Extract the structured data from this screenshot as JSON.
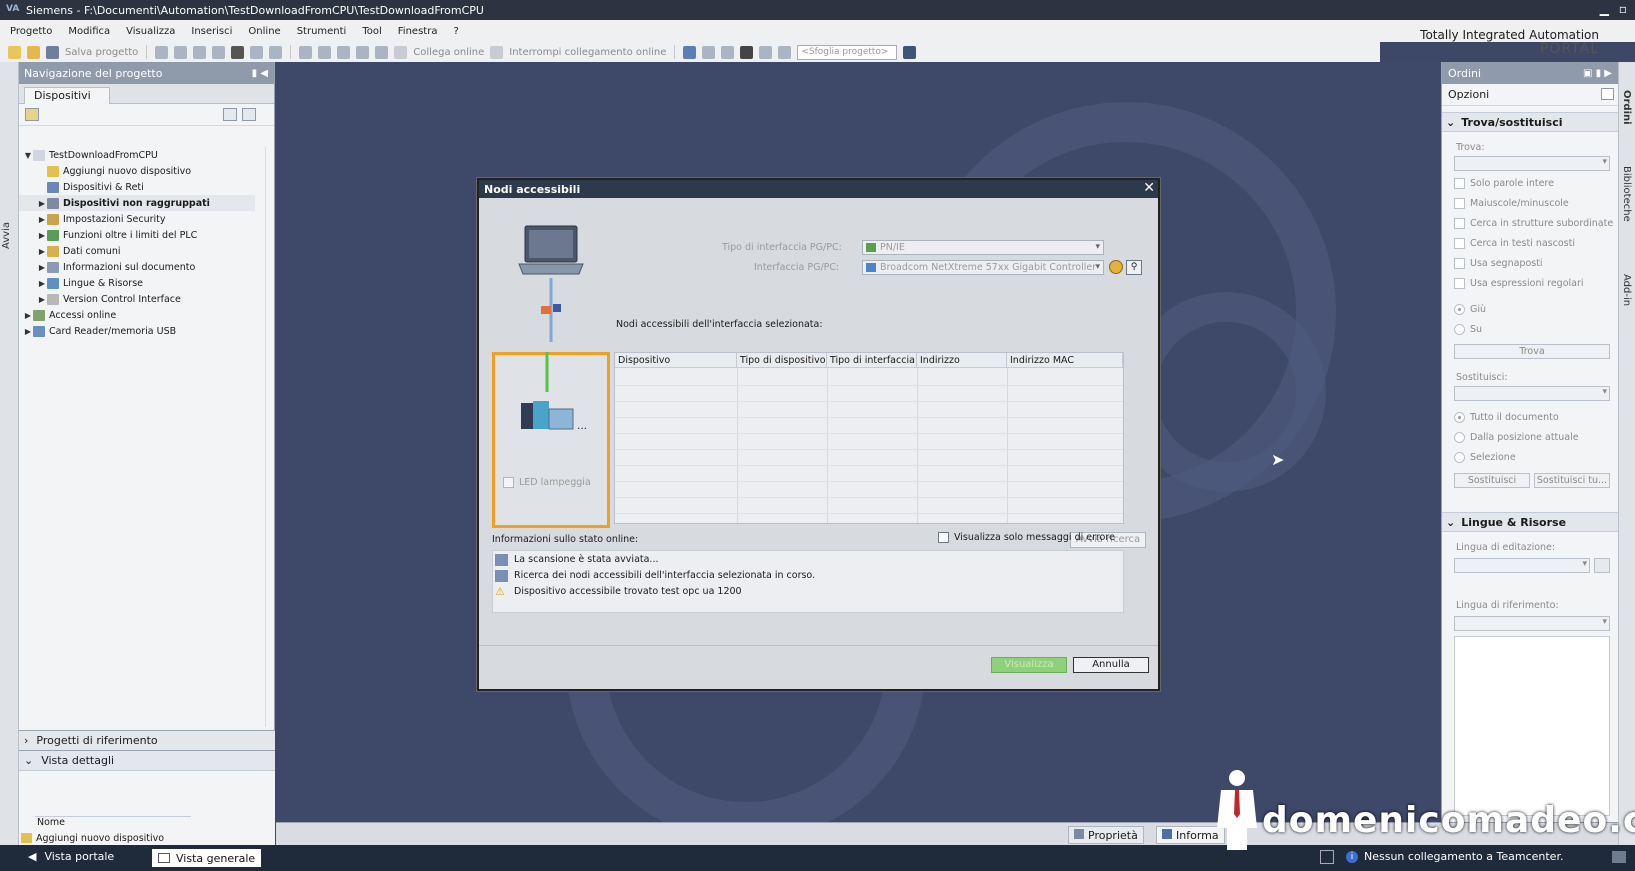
{
  "window": {
    "title": "Siemens  -  F:\\Documenti\\Automation\\TestDownloadFromCPU\\TestDownloadFromCPU"
  },
  "menu": [
    "Progetto",
    "Modifica",
    "Visualizza",
    "Inserisci",
    "Online",
    "Strumenti",
    "Tool",
    "Finestra",
    "?"
  ],
  "brand": {
    "line1": "Totally Integrated Automation",
    "line2": "PORTAL"
  },
  "toolbar": {
    "save_label": "Salva progetto",
    "go_online_label": "Collega online",
    "go_offline_label": "Interrompi collegamento online",
    "search_placeholder": "<Sfoglia progetto>"
  },
  "left_strip": {
    "label": "Avvia"
  },
  "project_nav": {
    "title": "Navigazione del progetto",
    "tab": "Dispositivi",
    "tree": [
      {
        "label": "TestDownloadFromCPU",
        "level": 0,
        "arrow": "▼",
        "color": "#cfd6e2"
      },
      {
        "label": "Aggiungi nuovo dispositivo",
        "level": 1,
        "arrow": "",
        "color": "#e2c24a"
      },
      {
        "label": "Dispositivi & Reti",
        "level": 1,
        "arrow": "",
        "color": "#6b86b8"
      },
      {
        "label": "Dispositivi non raggruppati",
        "level": 1,
        "arrow": "▶",
        "color": "#7d8aa0",
        "bold": true
      },
      {
        "label": "Impostazioni Security",
        "level": 1,
        "arrow": "▶",
        "color": "#c9a44a"
      },
      {
        "label": "Funzioni oltre i limiti del PLC",
        "level": 1,
        "arrow": "▶",
        "color": "#5a9c58"
      },
      {
        "label": "Dati comuni",
        "level": 1,
        "arrow": "▶",
        "color": "#d6b14c"
      },
      {
        "label": "Informazioni sul documento",
        "level": 1,
        "arrow": "▶",
        "color": "#8c9bb3"
      },
      {
        "label": "Lingue & Risorse",
        "level": 1,
        "arrow": "▶",
        "color": "#5e8fc7"
      },
      {
        "label": "Version Control Interface",
        "level": 1,
        "arrow": "▶",
        "color": "#b8b8b8"
      },
      {
        "label": "Accessi online",
        "level": 0,
        "arrow": "▶",
        "color": "#7fa36b"
      },
      {
        "label": "Card Reader/memoria USB",
        "level": 0,
        "arrow": "▶",
        "color": "#6a8fbf"
      }
    ],
    "reference_projects": "Progetti di riferimento",
    "details_view": "Vista dettagli",
    "details_col": "Nome",
    "details_row": "Aggiungi nuovo dispositivo"
  },
  "dialog": {
    "title": "Nodi accessibili",
    "iface_type_label": "Tipo di interfaccia PG/PC:",
    "iface_type_value": "PN/IE",
    "iface_label": "Interfaccia PG/PC:",
    "iface_value": "Broadcom NetXtreme 57xx Gigabit Controller",
    "led_label": "LED lampeggia",
    "nodes_label": "Nodi accessibili dell'interfaccia selezionata:",
    "columns": [
      "Dispositivo",
      "Tipo di dispositivo",
      "Tipo di interfaccia",
      "Indirizzo",
      "Indirizzo MAC"
    ],
    "search_button": "Avvia ricerca",
    "status_label": "Informazioni sullo stato online:",
    "errors_only_label": "Visualizza solo messaggi di errore",
    "messages": [
      "La scansione è stata avviata...",
      "Ricerca dei nodi accessibili dell'interfaccia selezionata in corso.",
      "Dispositivo accessibile trovato test opc ua 1200"
    ],
    "show_button": "Visualizza",
    "cancel_button": "Annulla"
  },
  "right_panel": {
    "title": "Ordini",
    "options": "Opzioni",
    "find_section": "Trova/sostituisci",
    "find_label": "Trova:",
    "checks": [
      "Solo parole intere",
      "Maiuscole/minuscole",
      "Cerca in strutture subordinate",
      "Cerca in testi nascosti",
      "Usa segnaposti",
      "Usa espressioni regolari"
    ],
    "dir_down": "Giù",
    "dir_up": "Su",
    "find_button": "Trova",
    "replace_label": "Sostituisci:",
    "scope_all": "Tutto il documento",
    "scope_current": "Dalla posizione attuale",
    "scope_selection": "Selezione",
    "replace_button": "Sostituisci",
    "replace_all_button": "Sostituisci tu...",
    "lang_section": "Lingue & Risorse",
    "edit_lang_label": "Lingua di editazione:",
    "ref_lang_label": "Lingua di riferimento:"
  },
  "right_strip_tabs": [
    "Ordini",
    "Biblioteche",
    "Add-in"
  ],
  "info_tabs": {
    "properties": "Proprietà",
    "info": "Informa"
  },
  "statusbar": {
    "portal_view": "Vista portale",
    "overview": "Vista generale",
    "teamcenter": "Nessun collegamento a Teamcenter."
  },
  "watermark": "domenicomadeo.com"
}
